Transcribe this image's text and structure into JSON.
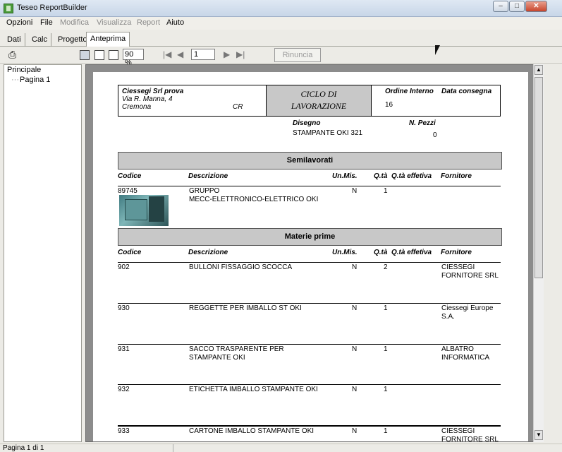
{
  "window": {
    "title": "Teseo ReportBuilder"
  },
  "menu": [
    {
      "label": "Opzioni",
      "enabled": true
    },
    {
      "label": "File",
      "enabled": true
    },
    {
      "label": "Modifica",
      "enabled": false
    },
    {
      "label": "Visualizza",
      "enabled": false
    },
    {
      "label": "Report",
      "enabled": false
    },
    {
      "label": "Aiuto",
      "enabled": true
    }
  ],
  "tabs": [
    {
      "label": "Dati"
    },
    {
      "label": "Calc"
    },
    {
      "label": "Progetto"
    },
    {
      "label": "Anteprima",
      "active": true
    }
  ],
  "toolbar": {
    "zoom": "90 %",
    "page": "1",
    "cancel_label": "Rinuncia"
  },
  "tree": {
    "root": "Principale",
    "child": "Pagina 1"
  },
  "status": {
    "text": "Pagina 1 di 1"
  },
  "report": {
    "company": {
      "name": "Ciessegi Srl prova",
      "address": "Via R. Manna, 4",
      "city": "Cremona",
      "province": "CR"
    },
    "title_line1": "CICLO DI",
    "title_line2": "LAVORAZIONE",
    "order_label": "Ordine Interno",
    "order_value": "16",
    "delivery_label": "Data consegna",
    "drawing_label": "Disegno",
    "drawing_value": "STAMPANTE OKI 321",
    "pieces_label": "N. Pezzi",
    "pieces_value": "0",
    "columns": {
      "code": "Codice",
      "desc": "Descrizione",
      "unit": "Un.Mis.",
      "qty": "Q.tà",
      "qty_eff": "Q.tà effetiva",
      "supplier": "Fornitore"
    },
    "semi_title": "Semilavorati",
    "semi_rows": [
      {
        "code": "89745",
        "desc1": "GRUPPO",
        "desc2": "MECC-ELETTRONICO-ELETTRICO OKI",
        "unit": "N",
        "qty": "1",
        "supplier1": "",
        "supplier2": ""
      }
    ],
    "raw_title": "Materie prime",
    "raw_rows": [
      {
        "code": "902",
        "desc1": "BULLONI FISSAGGIO SCOCCA",
        "desc2": "",
        "unit": "N",
        "qty": "2",
        "supplier1": "CIESSEGI",
        "supplier2": "FORNITORE SRL"
      },
      {
        "code": "930",
        "desc1": "REGGETTE PER IMBALLO ST OKI",
        "desc2": "",
        "unit": "N",
        "qty": "1",
        "supplier1": "Ciessegi Europe",
        "supplier2": "S.A."
      },
      {
        "code": "931",
        "desc1": "SACCO TRASPARENTE PER",
        "desc2": "STAMPANTE OKI",
        "unit": "N",
        "qty": "1",
        "supplier1": "ALBATRO",
        "supplier2": "INFORMATICA"
      },
      {
        "code": "932",
        "desc1": "ETICHETTA IMBALLO STAMPANTE OKI",
        "desc2": "",
        "unit": "N",
        "qty": "1",
        "supplier1": "",
        "supplier2": ""
      },
      {
        "code": "933",
        "desc1": "CARTONE IMBALLO STAMPANTE OKI",
        "desc2": "",
        "unit": "N",
        "qty": "1",
        "supplier1": "CIESSEGI",
        "supplier2": "FORNITORE SRL"
      }
    ]
  }
}
